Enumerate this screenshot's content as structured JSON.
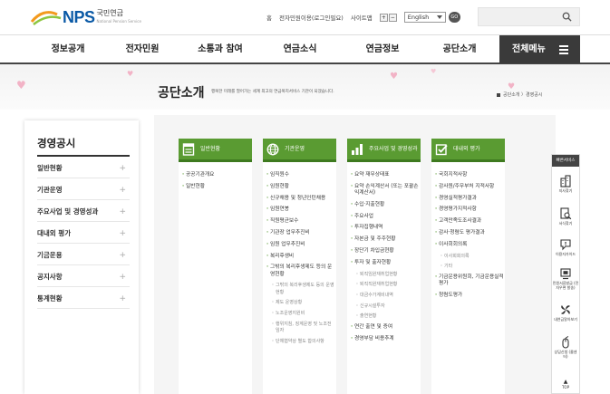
{
  "header": {
    "logo_text": "NPS",
    "logo_korean": "국민연금",
    "logo_sub": "National Pension Service",
    "util_links": [
      "홈",
      "전자민원이용(로그인필요)",
      "사이트맵"
    ],
    "font_plus": "+",
    "font_minus": "−",
    "language": "English",
    "go_label": "GO",
    "search_placeholder": ""
  },
  "gnb": {
    "items": [
      "정보공개",
      "전자민원",
      "소통과 참여",
      "연금소식",
      "연금정보",
      "공단소개"
    ],
    "all_menu": "전체메뉴"
  },
  "visual": {
    "title": "공단소개",
    "description": "행복한 미래를 열어가는 세계 최고의 연금복지서비스 기관이 되겠습니다.",
    "breadcrumb": "공단소개 〉경영공시"
  },
  "lnb": {
    "title": "경영공시",
    "items": [
      "일반현황",
      "기관운영",
      "주요사업 및 경영성과",
      "대내외 평가",
      "기금운용",
      "공지사항",
      "통계현황"
    ]
  },
  "cards": [
    {
      "title": "일반현황",
      "icon": "document-icon",
      "items": [
        {
          "label": "공공기관개요",
          "sub": false
        },
        {
          "label": "일반현황",
          "sub": false
        }
      ]
    },
    {
      "title": "기관운영",
      "icon": "globe-icon",
      "items": [
        {
          "label": "임직원수",
          "sub": false
        },
        {
          "label": "임원현황",
          "sub": false
        },
        {
          "label": "신규채용 및 청년인턴채용",
          "sub": false
        },
        {
          "label": "임원연봉",
          "sub": false
        },
        {
          "label": "직원평균보수",
          "sub": false
        },
        {
          "label": "기관장 업무추진비",
          "sub": false
        },
        {
          "label": "임원 업무추진비",
          "sub": false
        },
        {
          "label": "복리후생비",
          "sub": false
        },
        {
          "label": "그밖의 복리후생제도 등의 운영현황",
          "sub": false
        },
        {
          "label": "그밖의 복리후생제도 등의 운영현황",
          "sub": true
        },
        {
          "label": "제도 운영상황",
          "sub": true
        },
        {
          "label": "노조운영지원비",
          "sub": true
        },
        {
          "label": "행위지침, 징계운영 및 노조전임자",
          "sub": true
        },
        {
          "label": "단체협약상 별도 합의사항",
          "sub": true
        }
      ]
    },
    {
      "title": "주요사업 및 경영성과",
      "icon": "bar-chart-icon",
      "items": [
        {
          "label": "요약 재무상태표",
          "sub": false
        },
        {
          "label": "요약 손익계산서 (또는 포괄손익계산서)",
          "sub": false
        },
        {
          "label": "수입·지출현황",
          "sub": false
        },
        {
          "label": "주요사업",
          "sub": false
        },
        {
          "label": "투자집행내역",
          "sub": false
        },
        {
          "label": "자본금 및 주주현황",
          "sub": false
        },
        {
          "label": "장단기 차입금현황",
          "sub": false
        },
        {
          "label": "투자 및 출자현황",
          "sub": false
        },
        {
          "label": "퇴직임원재취업현황",
          "sub": true
        },
        {
          "label": "퇴직직원재취업현황",
          "sub": true
        },
        {
          "label": "대금수가계비내역",
          "sub": true
        },
        {
          "label": "신규시설투자",
          "sub": true
        },
        {
          "label": "출연현황",
          "sub": true
        },
        {
          "label": "연간 출연 및 증여",
          "sub": false
        },
        {
          "label": "경영부담 비용추계",
          "sub": false
        }
      ]
    },
    {
      "title": "대내외 평가",
      "icon": "checkbox-icon",
      "items": [
        {
          "label": "국회지적사항",
          "sub": false
        },
        {
          "label": "감사원/주무부처 지적사항",
          "sub": false
        },
        {
          "label": "경영실적평가결과",
          "sub": false
        },
        {
          "label": "경영평가지적사항",
          "sub": false
        },
        {
          "label": "고객만족도조사결과",
          "sub": false
        },
        {
          "label": "감사·청렴도 평가결과",
          "sub": false
        },
        {
          "label": "이사회회의록",
          "sub": false
        },
        {
          "label": "이사회회의록",
          "sub": true
        },
        {
          "label": "기타",
          "sub": true
        },
        {
          "label": "기금운용위원회, 기금운용실적평가",
          "sub": false
        },
        {
          "label": "청렴도평가",
          "sub": false
        }
      ]
    }
  ],
  "quick": {
    "title": "빠른서비스",
    "items": [
      {
        "label": "지사찾기",
        "icon": "building-icon"
      },
      {
        "label": "서식찾기",
        "icon": "form-search-icon"
      },
      {
        "label": "이용자가이드",
        "icon": "chat-icon"
      },
      {
        "label": "민원서류발급 (전자우편 발송)",
        "icon": "monitor-icon"
      },
      {
        "label": "내연금알아보기",
        "icon": "pinwheel-icon"
      },
      {
        "label": "상담신청 (콜센터)",
        "icon": "mouse-icon"
      }
    ],
    "top_label": "TOP"
  }
}
